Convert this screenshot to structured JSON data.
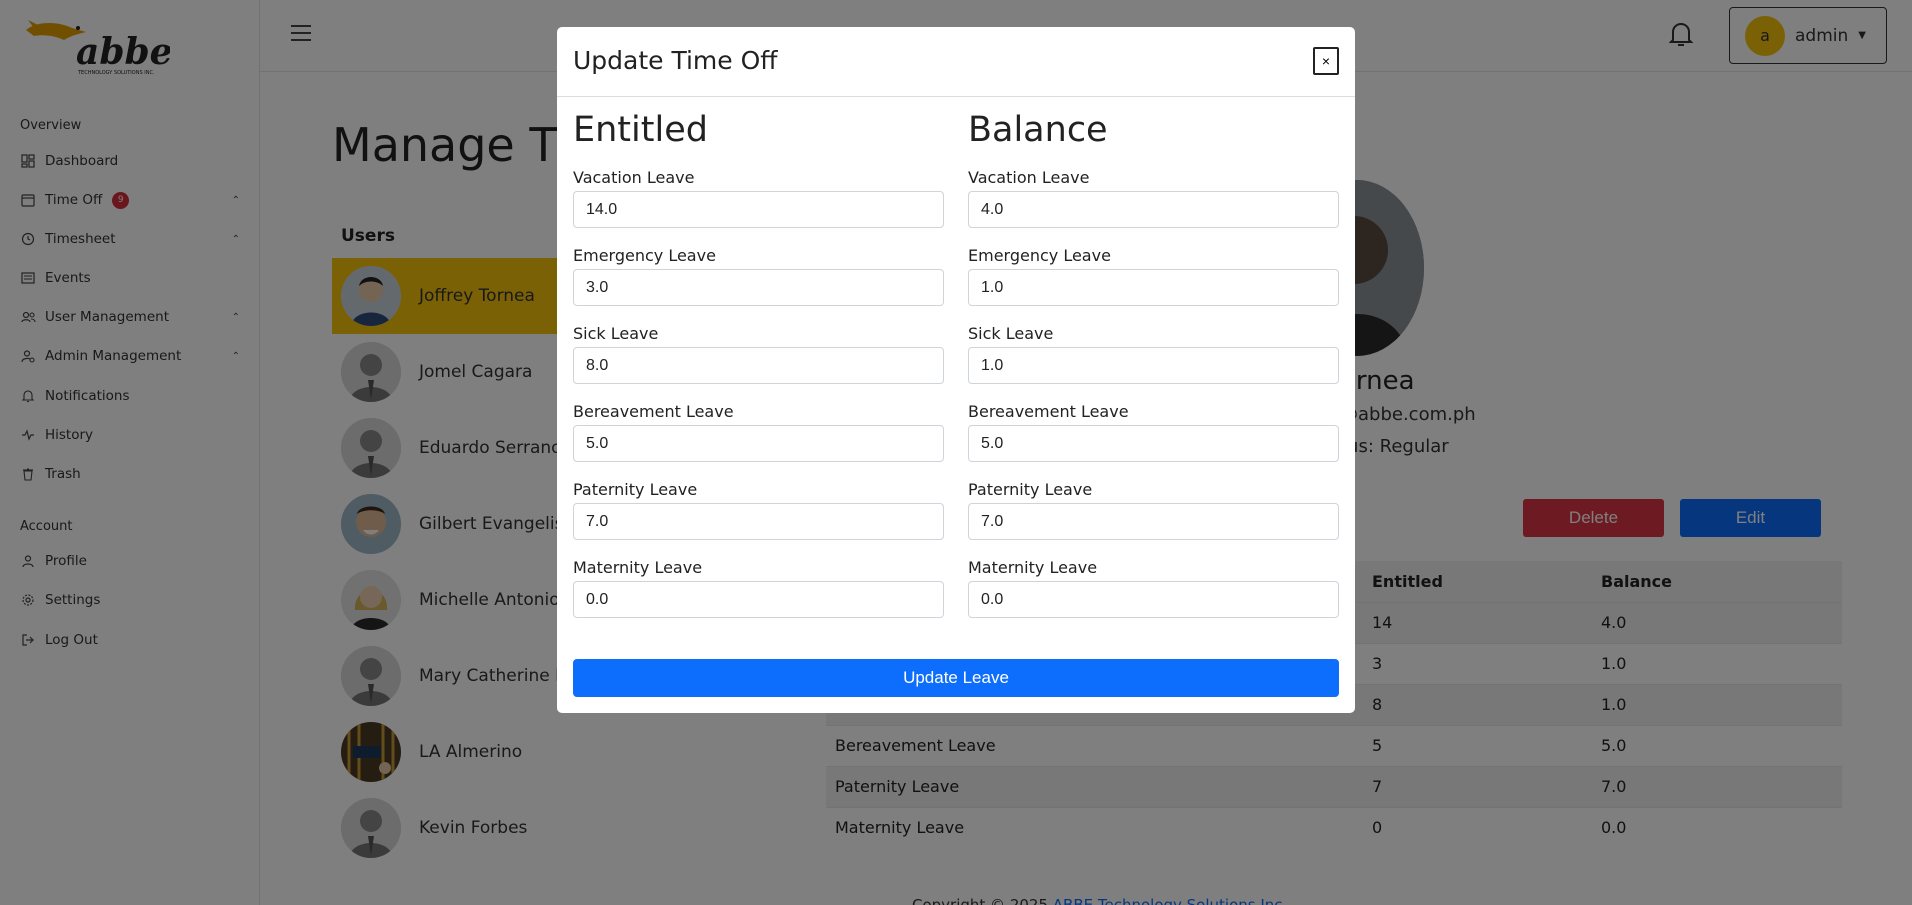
{
  "sidebar": {
    "brand": "abbe",
    "brand_tagline": "TECHNOLOGY SOLUTIONS INC.",
    "sections": [
      {
        "label": "Overview"
      },
      {
        "label": "Account"
      }
    ],
    "items": [
      {
        "label": "Dashboard",
        "icon": "dashboard-icon"
      },
      {
        "label": "Time Off",
        "icon": "calendar-icon",
        "badge": "9"
      },
      {
        "label": "Timesheet",
        "icon": "clock-icon"
      },
      {
        "label": "Events",
        "icon": "list-icon"
      },
      {
        "label": "User Management",
        "icon": "users-icon"
      },
      {
        "label": "Admin Management",
        "icon": "admin-icon"
      },
      {
        "label": "Notifications",
        "icon": "bell-icon"
      },
      {
        "label": "History",
        "icon": "activity-icon"
      },
      {
        "label": "Trash",
        "icon": "trash-icon"
      },
      {
        "label": "Profile",
        "icon": "user-icon"
      },
      {
        "label": "Settings",
        "icon": "gear-icon"
      },
      {
        "label": "Log Out",
        "icon": "logout-icon"
      }
    ]
  },
  "header": {
    "avatar_initial": "a",
    "user_name": "admin"
  },
  "main": {
    "page_title": "Manage Time Off",
    "users_label": "Users",
    "users": [
      {
        "name": "Joffrey Tornea"
      },
      {
        "name": "Jomel Cagara"
      },
      {
        "name": "Eduardo Serrano"
      },
      {
        "name": "Gilbert Evangelista"
      },
      {
        "name": "Michelle Antonio"
      },
      {
        "name": "Mary Catherine Pe"
      },
      {
        "name": "LA Almerino"
      },
      {
        "name": "Kevin Forbes"
      }
    ],
    "profile": {
      "name": "ornea",
      "email": "@abbe.com.ph",
      "status": "tus: Regular"
    },
    "delete_label": "Delete",
    "edit_label": "Edit",
    "table": {
      "headers": [
        "",
        "Entitled",
        "Balance"
      ],
      "rows": [
        {
          "type": "",
          "entitled": "14",
          "balance": "4.0"
        },
        {
          "type": "",
          "entitled": "3",
          "balance": "1.0"
        },
        {
          "type": "",
          "entitled": "8",
          "balance": "1.0"
        },
        {
          "type": "Bereavement Leave",
          "entitled": "5",
          "balance": "5.0"
        },
        {
          "type": "Paternity Leave",
          "entitled": "7",
          "balance": "7.0"
        },
        {
          "type": "Maternity Leave",
          "entitled": "0",
          "balance": "0.0"
        }
      ]
    },
    "footer_prefix": "Copyright © 2025 ",
    "footer_link": "ABBE Technology Solutions Inc."
  },
  "modal": {
    "title": "Update Time Off",
    "close_label": "×",
    "entitled_title": "Entitled",
    "balance_title": "Balance",
    "fields": [
      {
        "label": "Vacation Leave",
        "entitled": "14.0",
        "balance": "4.0"
      },
      {
        "label": "Emergency Leave",
        "entitled": "3.0",
        "balance": "1.0"
      },
      {
        "label": "Sick Leave",
        "entitled": "8.0",
        "balance": "1.0"
      },
      {
        "label": "Bereavement Leave",
        "entitled": "5.0",
        "balance": "5.0"
      },
      {
        "label": "Paternity Leave",
        "entitled": "7.0",
        "balance": "7.0"
      },
      {
        "label": "Maternity Leave",
        "entitled": "0.0",
        "balance": "0.0"
      }
    ],
    "submit_label": "Update Leave"
  },
  "colors": {
    "accent_yellow": "#f4c20d",
    "primary_blue": "#0d6efd",
    "danger_red": "#dc3545",
    "badge_red": "#d32f3a"
  }
}
